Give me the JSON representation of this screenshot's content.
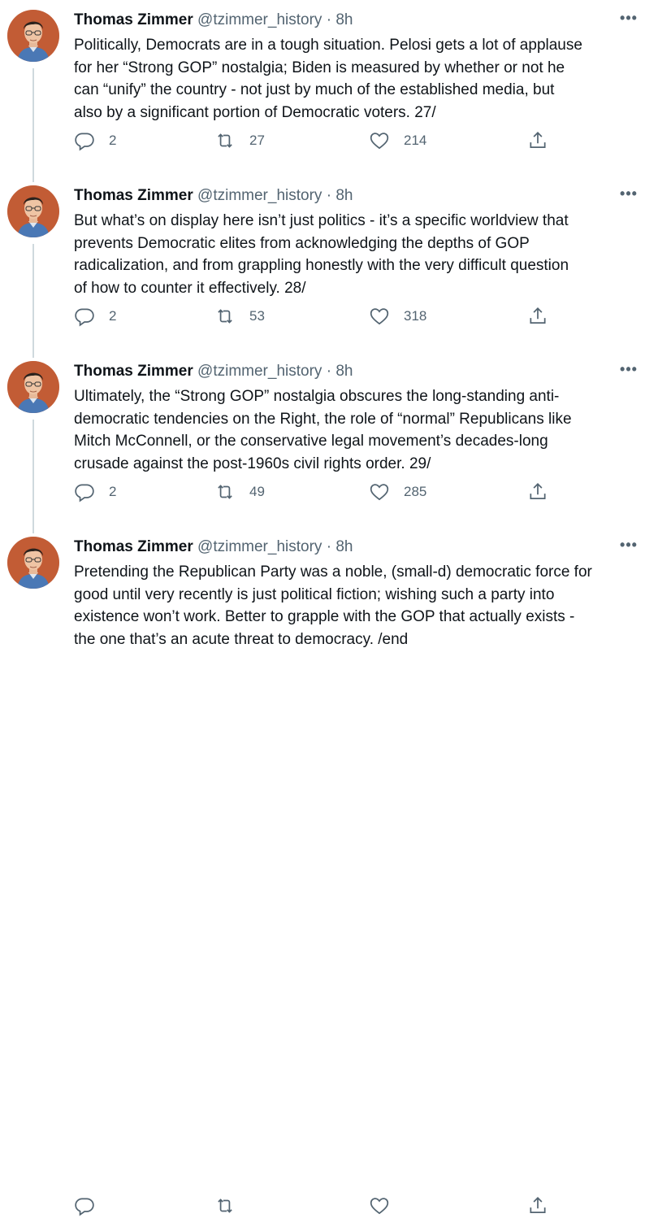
{
  "tweets": [
    {
      "name": "Thomas Zimmer",
      "handle": "@tzimmer_history",
      "dot": "·",
      "time": "8h",
      "more": "•••",
      "lines": [
        "Politically, Democrats are in a tough situation. Pelosi gets a lot of applause",
        "for her “Strong GOP” nostalgia; Biden is measured by whether or not he",
        "can “unify” the country - not just by much of the established media, but",
        "also by a significant portion of Democratic voters. 27/"
      ],
      "replies": "2",
      "retweets": "27",
      "likes": "214"
    },
    {
      "name": "Thomas Zimmer",
      "handle": "@tzimmer_history",
      "dot": "·",
      "time": "8h",
      "more": "•••",
      "lines": [
        "But what’s on display here isn’t just politics - it’s a specific worldview that",
        "prevents Democratic elites from acknowledging the depths of GOP",
        "radicalization, and from grappling honestly with the very difficult question",
        "of how to counter it effectively. 28/"
      ],
      "replies": "2",
      "retweets": "53",
      "likes": "318"
    },
    {
      "name": "Thomas Zimmer",
      "handle": "@tzimmer_history",
      "dot": "·",
      "time": "8h",
      "more": "•••",
      "lines": [
        "Ultimately, the “Strong GOP” nostalgia obscures the long-standing anti-",
        "democratic tendencies on the Right, the role of “normal” Republicans like",
        "Mitch McConnell, or the conservative legal movement’s decades-long",
        "crusade against the post-1960s civil rights order. 29/"
      ],
      "replies": "2",
      "retweets": "49",
      "likes": "285"
    },
    {
      "name": "Thomas Zimmer",
      "handle": "@tzimmer_history",
      "dot": "·",
      "time": "8h",
      "more": "•••",
      "lines": [
        "Pretending the Republican Party was a noble, (small-d) democratic force for",
        "good until very recently is just political fiction; wishing such a party into",
        "existence won’t work. Better to grapple with the GOP that actually exists -",
        "the one that’s an acute threat to democracy. /end"
      ]
    }
  ],
  "colors": {
    "text": "#0f1419",
    "secondary": "#536471",
    "thread_line": "#cfd9de",
    "avatar_bg": "#c8603a"
  },
  "icons": {
    "avatar": "profile-photo",
    "reply": "reply-icon",
    "retweet": "retweet-icon",
    "like": "like-icon",
    "share": "share-icon",
    "more": "more-icon"
  }
}
